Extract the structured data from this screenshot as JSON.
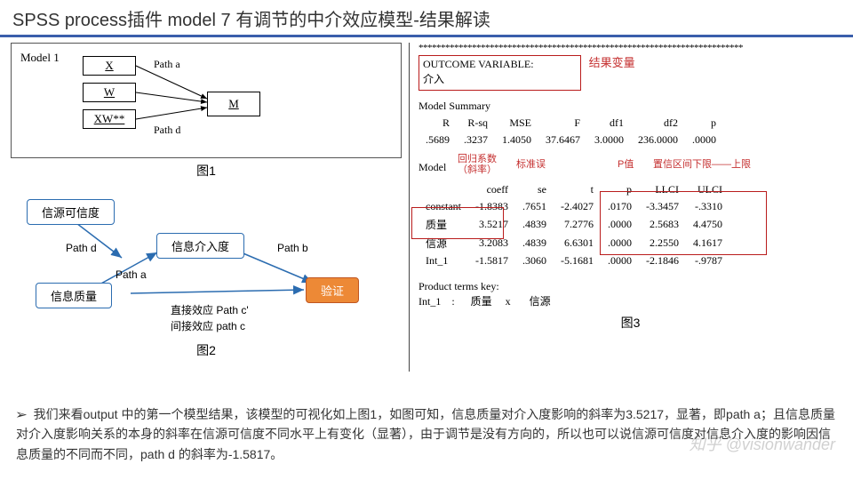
{
  "title": "SPSS process插件 model 7 有调节的中介效应模型-结果解读",
  "fig1": {
    "model_label": "Model 1",
    "x": "X",
    "w": "W",
    "xw": "XW**",
    "m": "M",
    "path_a": "Path a",
    "path_d": "Path d",
    "caption": "图1"
  },
  "fig2": {
    "src_cred": "信源可信度",
    "intervene": "信息介入度",
    "quality": "信息质量",
    "verify": "验证",
    "path_d": "Path d",
    "path_a": "Path a",
    "path_b": "Path b",
    "direct": "直接效应 Path c'",
    "indirect": "间接效应 path c",
    "caption": "图2"
  },
  "fig3": {
    "asterisks": "*************************************************************************",
    "ov_label": "OUTCOME VARIABLE:",
    "ov_value": "介入",
    "ov_ann": "结果变量",
    "ms_label": "Model Summary",
    "ms_headers": [
      "R",
      "R-sq",
      "MSE",
      "F",
      "df1",
      "df2",
      "p"
    ],
    "ms_values": [
      ".5689",
      ".3237",
      "1.4050",
      "37.6467",
      "3.0000",
      "236.0000",
      ".0000"
    ],
    "model_label": "Model",
    "ann_coef": "回归系数\n（斜率）",
    "ann_se": "标准误",
    "ann_p": "P值",
    "ann_ci": "置信区间下限——上限",
    "m_headers": [
      "",
      "coeff",
      "se",
      "t",
      "p",
      "LLCI",
      "ULCI"
    ],
    "m_rows": [
      [
        "constant",
        "-1.8383",
        ".7651",
        "-2.4027",
        ".0170",
        "-3.3457",
        "-.3310"
      ],
      [
        "质量",
        "3.5217",
        ".4839",
        "7.2776",
        ".0000",
        "2.5683",
        "4.4750"
      ],
      [
        "信源",
        "3.2083",
        ".4839",
        "6.6301",
        ".0000",
        "2.2550",
        "4.1617"
      ],
      [
        "Int_1",
        "-1.5817",
        ".3060",
        "-5.1681",
        ".0000",
        "-2.1846",
        "-.9787"
      ]
    ],
    "ptk_label": "Product terms key:",
    "ptk_line": "Int_1    :      质量     x       信源",
    "caption": "图3"
  },
  "body": {
    "bullet": "➢",
    "text": "我们来看output 中的第一个模型结果，该模型的可视化如上图1，如图可知，信息质量对介入度影响的斜率为3.5217，显著，即path a；且信息质量对介入度影响关系的本身的斜率在信源可信度不同水平上有变化（显著），由于调节是没有方向的，所以也可以说信源可信度对信息介入度的影响因信息质量的不同而不同，path d 的斜率为-1.5817。"
  },
  "watermark": "知乎 @visionwander"
}
